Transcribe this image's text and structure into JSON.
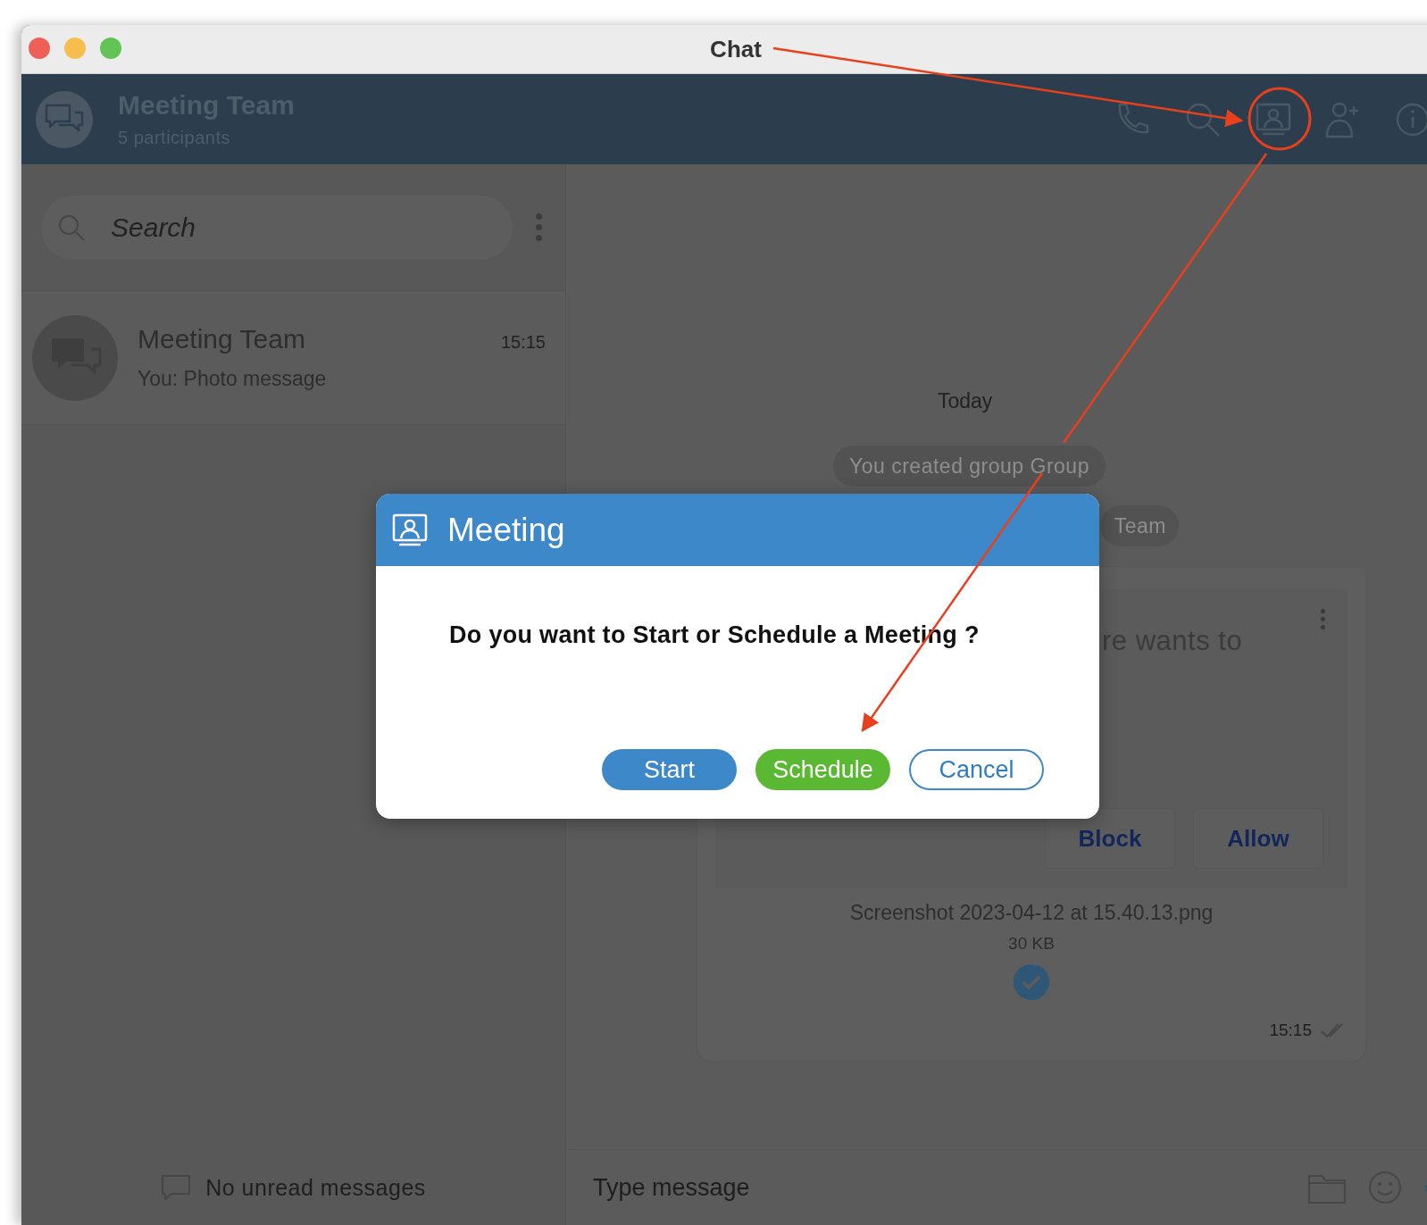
{
  "window": {
    "title": "Chat"
  },
  "header": {
    "name": "Meeting Team",
    "subtitle": "5 participants"
  },
  "sidebar": {
    "search": {
      "placeholder": "Search"
    },
    "chats": [
      {
        "name": "Meeting Team",
        "time": "15:15",
        "preview": "You: Photo message"
      }
    ],
    "footer": "No unread messages"
  },
  "conversation": {
    "date": "Today",
    "notices": [
      "You created group Group",
      "Team"
    ],
    "message": {
      "partial_text": "re wants to",
      "actions": [
        "Block",
        "Allow"
      ],
      "file_name": "Screenshot 2023-04-12 at 15.40.13.png",
      "file_size": "30 KB",
      "time": "15:15"
    }
  },
  "composer": {
    "placeholder": "Type message"
  },
  "dialog": {
    "title": "Meeting",
    "question": "Do you want to Start or Schedule a Meeting ?",
    "buttons": [
      {
        "label": "Start",
        "kind": "primary"
      },
      {
        "label": "Schedule",
        "kind": "success"
      },
      {
        "label": "Cancel",
        "kind": "outline"
      }
    ]
  }
}
